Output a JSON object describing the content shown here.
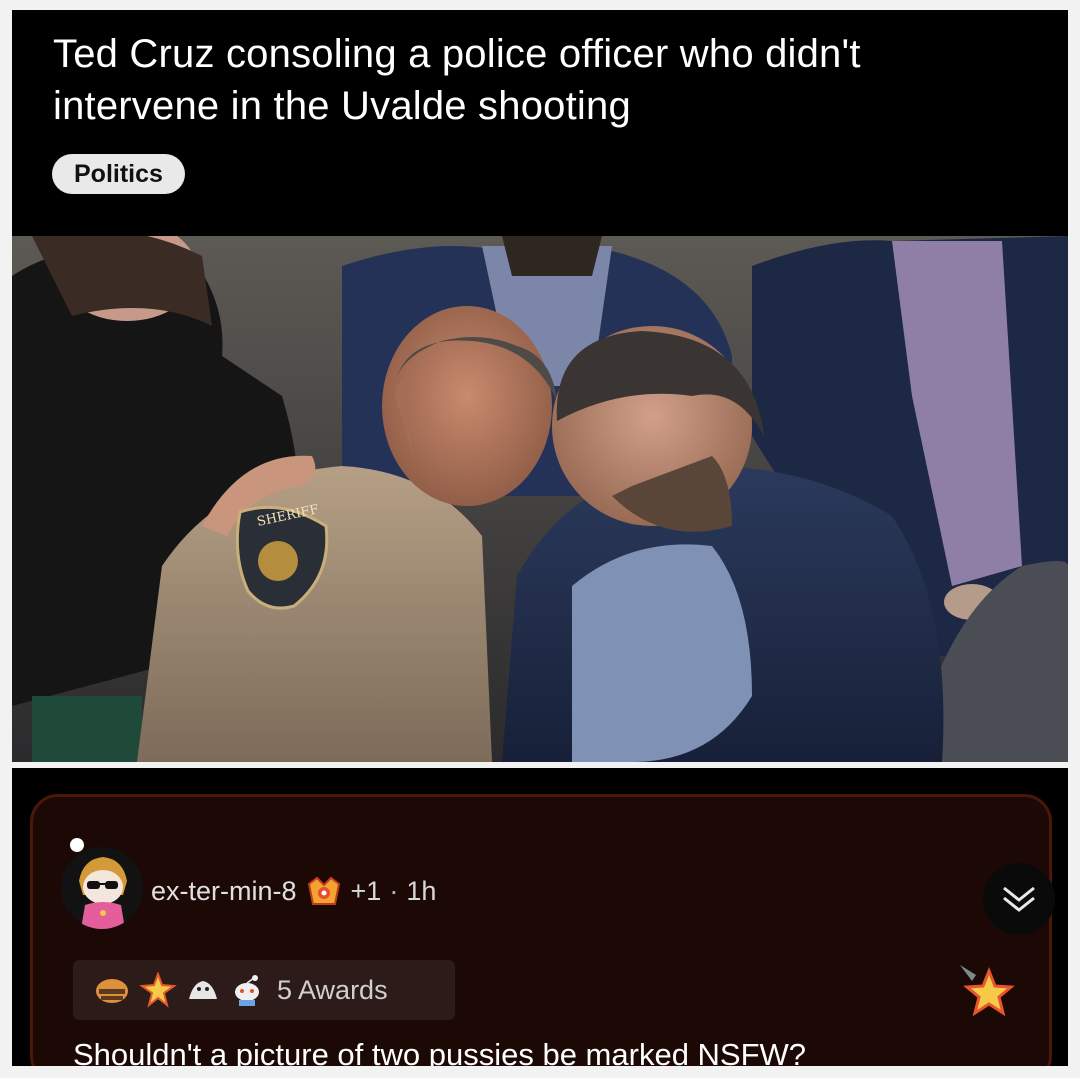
{
  "post": {
    "title": "Ted Cruz consoling a police officer who didn't intervene in the Uvalde shooting",
    "flair": "Politics",
    "image": {
      "patch_text": "SHERIFF"
    }
  },
  "comment": {
    "username": "ex-ter-min-8",
    "score": "+1",
    "separator": "·",
    "age": "1h",
    "awards_label": "5 Awards",
    "body": "Shouldn't a picture of two pussies be marked NSFW?",
    "icons": [
      "user-flair-icon",
      "collapse-chevron-icon",
      "award-icons",
      "award-star-icon"
    ]
  },
  "colors": {
    "post_bg": "#000000",
    "comment_bg": "#1c0906",
    "comment_border": "#4a1708",
    "flair_bg": "#e9e9e9"
  }
}
